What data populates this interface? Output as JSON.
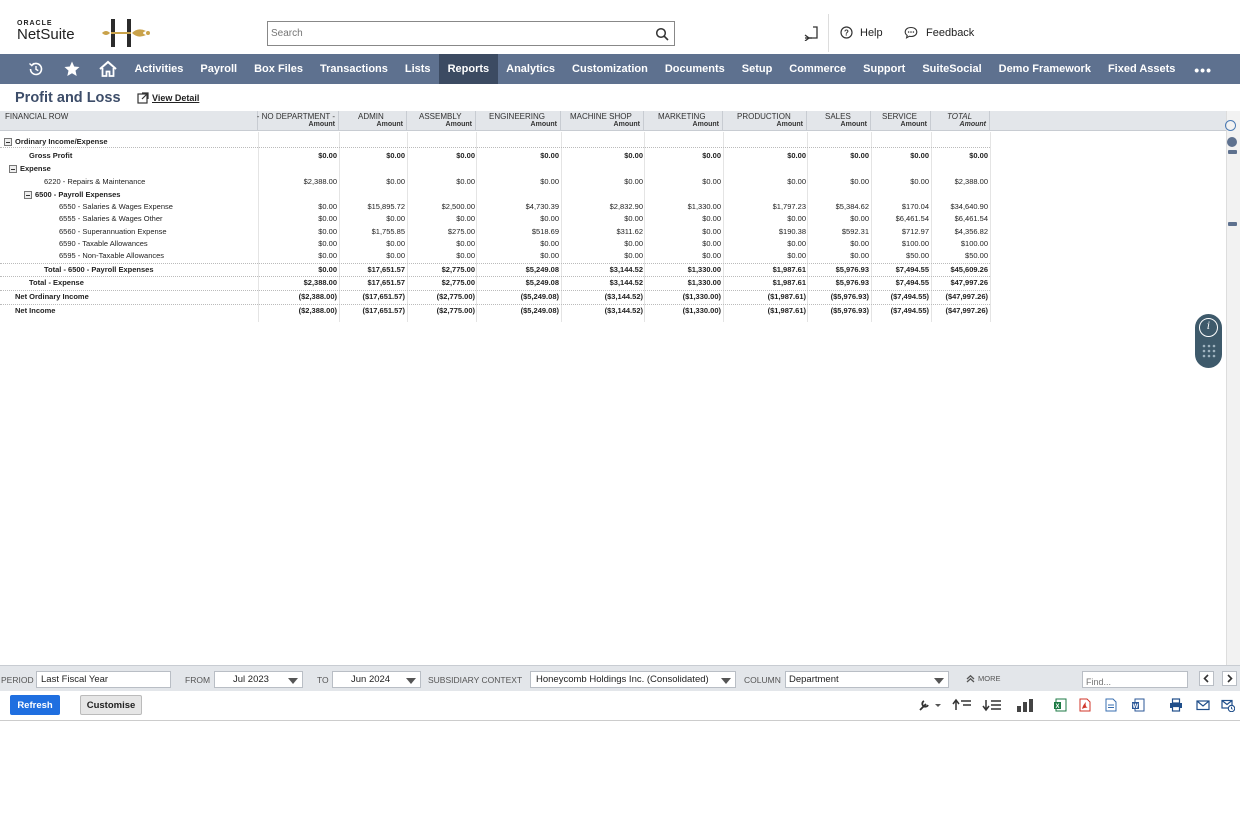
{
  "header": {
    "brand_top": "ORACLE",
    "brand_name": "NetSuite",
    "search_placeholder": "Search",
    "help_label": "Help",
    "feedback_label": "Feedback"
  },
  "nav": {
    "items": [
      "Activities",
      "Payroll",
      "Box Files",
      "Transactions",
      "Lists",
      "Reports",
      "Analytics",
      "Customization",
      "Documents",
      "Setup",
      "Commerce",
      "Support",
      "SuiteSocial",
      "Demo Framework",
      "Fixed Assets"
    ],
    "active": "Reports",
    "more": "•••"
  },
  "page": {
    "title": "Profit and Loss",
    "view_detail": "View Detail"
  },
  "report": {
    "row_header": "FINANCIAL ROW",
    "sub_header": "Amount",
    "columns": [
      "- NO DEPARTMENT -",
      "ADMIN",
      "ASSEMBLY",
      "ENGINEERING",
      "MACHINE SHOP",
      "MARKETING",
      "PRODUCTION",
      "SALES",
      "SERVICE",
      "TOTAL"
    ],
    "rows": [
      {
        "label": "Ordinary Income/Expense",
        "values": []
      },
      {
        "label": "Gross Profit",
        "values": [
          "$0.00",
          "$0.00",
          "$0.00",
          "$0.00",
          "$0.00",
          "$0.00",
          "$0.00",
          "$0.00",
          "$0.00",
          "$0.00"
        ]
      },
      {
        "label": "Expense",
        "values": []
      },
      {
        "label": "6220 - Repairs & Maintenance",
        "values": [
          "$2,388.00",
          "$0.00",
          "$0.00",
          "$0.00",
          "$0.00",
          "$0.00",
          "$0.00",
          "$0.00",
          "$0.00",
          "$2,388.00"
        ]
      },
      {
        "label": "6500 - Payroll Expenses",
        "values": []
      },
      {
        "label": "6550 - Salaries & Wages Expense",
        "values": [
          "$0.00",
          "$15,895.72",
          "$2,500.00",
          "$4,730.39",
          "$2,832.90",
          "$1,330.00",
          "$1,797.23",
          "$5,384.62",
          "$170.04",
          "$34,640.90"
        ]
      },
      {
        "label": "6555 - Salaries & Wages Other",
        "values": [
          "$0.00",
          "$0.00",
          "$0.00",
          "$0.00",
          "$0.00",
          "$0.00",
          "$0.00",
          "$0.00",
          "$6,461.54",
          "$6,461.54"
        ]
      },
      {
        "label": "6560 - Superannuation Expense",
        "values": [
          "$0.00",
          "$1,755.85",
          "$275.00",
          "$518.69",
          "$311.62",
          "$0.00",
          "$190.38",
          "$592.31",
          "$712.97",
          "$4,356.82"
        ]
      },
      {
        "label": "6590 - Taxable Allowances",
        "values": [
          "$0.00",
          "$0.00",
          "$0.00",
          "$0.00",
          "$0.00",
          "$0.00",
          "$0.00",
          "$0.00",
          "$100.00",
          "$100.00"
        ]
      },
      {
        "label": "6595 - Non-Taxable Allowances",
        "values": [
          "$0.00",
          "$0.00",
          "$0.00",
          "$0.00",
          "$0.00",
          "$0.00",
          "$0.00",
          "$0.00",
          "$50.00",
          "$50.00"
        ]
      },
      {
        "label": "Total - 6500 - Payroll Expenses",
        "values": [
          "$0.00",
          "$17,651.57",
          "$2,775.00",
          "$5,249.08",
          "$3,144.52",
          "$1,330.00",
          "$1,987.61",
          "$5,976.93",
          "$7,494.55",
          "$45,609.26"
        ]
      },
      {
        "label": "Total - Expense",
        "values": [
          "$2,388.00",
          "$17,651.57",
          "$2,775.00",
          "$5,249.08",
          "$3,144.52",
          "$1,330.00",
          "$1,987.61",
          "$5,976.93",
          "$7,494.55",
          "$47,997.26"
        ]
      },
      {
        "label": "Net Ordinary Income",
        "values": [
          "($2,388.00)",
          "($17,651.57)",
          "($2,775.00)",
          "($5,249.08)",
          "($3,144.52)",
          "($1,330.00)",
          "($1,987.61)",
          "($5,976.93)",
          "($7,494.55)",
          "($47,997.26)"
        ]
      },
      {
        "label": "Net Income",
        "values": [
          "($2,388.00)",
          "($17,651.57)",
          "($2,775.00)",
          "($5,249.08)",
          "($3,144.52)",
          "($1,330.00)",
          "($1,987.61)",
          "($5,976.93)",
          "($7,494.55)",
          "($47,997.26)"
        ]
      }
    ]
  },
  "filters": {
    "period_label": "PERIOD",
    "period_value": "Last Fiscal Year",
    "from_label": "FROM",
    "from_value": "Jul 2023",
    "to_label": "TO",
    "to_value": "Jun 2024",
    "subsidiary_label": "SUBSIDIARY CONTEXT",
    "subsidiary_value": "Honeycomb Holdings Inc. (Consolidated)",
    "column_label": "COLUMN",
    "column_value": "Department",
    "more_label": "MORE",
    "find_placeholder": "Find..."
  },
  "actions": {
    "refresh": "Refresh",
    "customise": "Customise"
  },
  "colors": {
    "nav_bg": "#5e718f",
    "nav_active": "#3c4b62",
    "title": "#3d4d69",
    "refresh": "#1f6fe0"
  }
}
